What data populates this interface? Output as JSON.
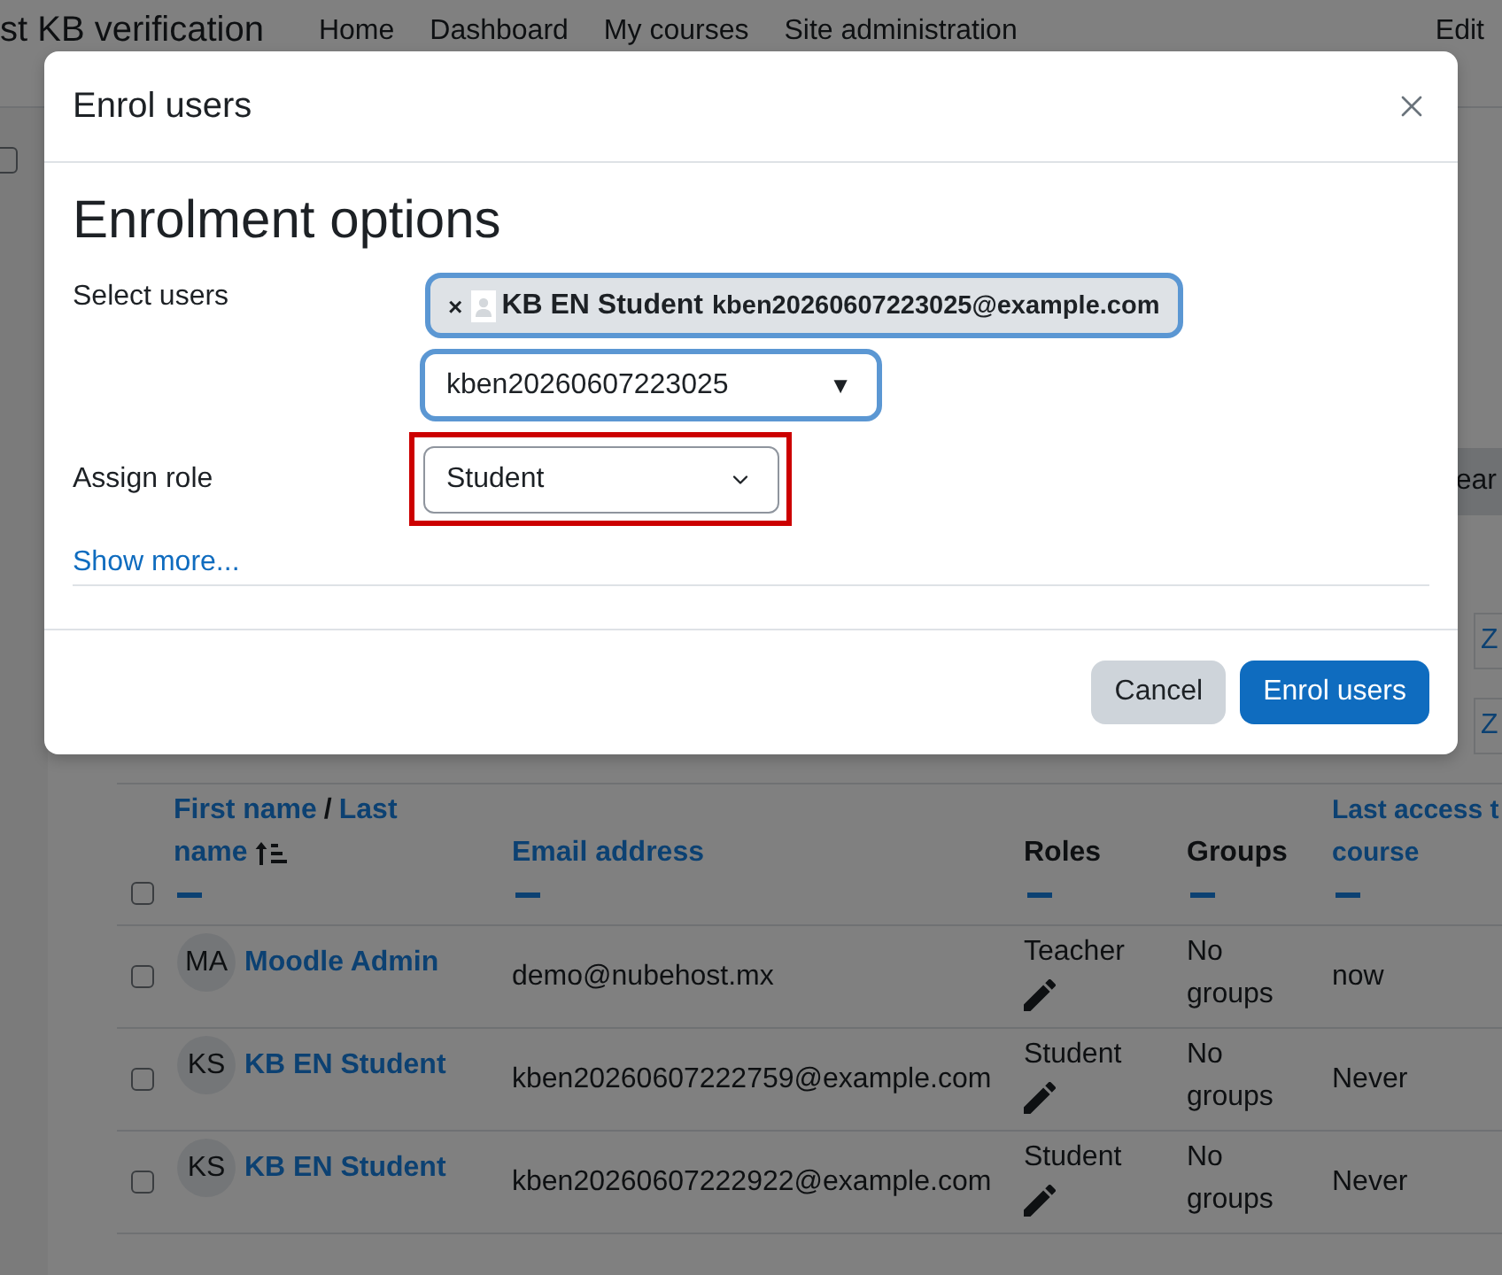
{
  "page_header": {
    "site_title": "st KB verification",
    "nav": [
      "Home",
      "Dashboard",
      "My courses",
      "Site administration"
    ],
    "edit_mode_label": "Edit"
  },
  "page_checkbox": {
    "checked": false
  },
  "filter_bar": {
    "clear_button": "ear",
    "letter_filters": [
      "Z",
      "Z"
    ]
  },
  "participants_table": {
    "select_all": {
      "checked": false
    },
    "columns": [
      {
        "kind": "name",
        "first": "First name",
        "separator": "/",
        "last_lines": [
          "Last",
          "name"
        ],
        "sorted": true,
        "collapsible": true
      },
      {
        "kind": "text",
        "lines": [
          "Email address"
        ],
        "sortable": true,
        "collapsible": true
      },
      {
        "kind": "text",
        "lines": [
          "Roles"
        ],
        "sortable": false,
        "collapsible": true
      },
      {
        "kind": "text",
        "lines": [
          "Groups"
        ],
        "sortable": false,
        "collapsible": true
      },
      {
        "kind": "text",
        "lines": [
          "Last access t",
          "course"
        ],
        "sortable": true,
        "collapsible": true
      }
    ],
    "rows": [
      {
        "checked": false,
        "initials": "MA",
        "name": "Moodle Admin",
        "email": "demo@nubehost.mx",
        "role": "Teacher",
        "groups": "No groups",
        "last_access": "now"
      },
      {
        "checked": false,
        "initials": "KS",
        "name": "KB EN Student",
        "email": "kben20260607222759@example.com",
        "role": "Student",
        "groups": "No groups",
        "last_access": "Never"
      },
      {
        "checked": false,
        "initials": "KS",
        "name": "KB EN Student",
        "email": "kben20260607222922@example.com",
        "role": "Student",
        "groups": "No groups",
        "last_access": "Never"
      }
    ]
  },
  "dialog": {
    "title": "Enrol users",
    "heading": "Enrolment options",
    "fields": [
      {
        "kind": "autocomplete",
        "label": "Select users",
        "selection": [
          {
            "remove_mark": "×",
            "name": "KB EN Student",
            "email": "kben20260607223025@example.com"
          }
        ],
        "value": "kben20260607223025",
        "arrow": "▼",
        "focused": true
      },
      {
        "kind": "select",
        "label": "Assign role",
        "value": "Student",
        "highlighted": true
      }
    ],
    "show_more": "Show more...",
    "buttons": [
      {
        "kind": "cancel",
        "label": "Cancel"
      },
      {
        "kind": "submit",
        "label": "Enrol users"
      }
    ]
  }
}
